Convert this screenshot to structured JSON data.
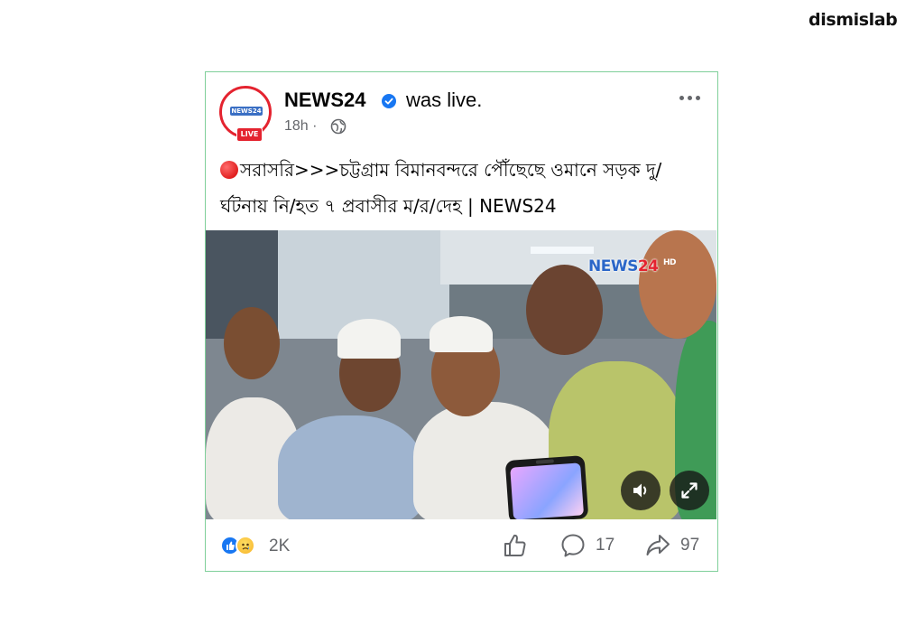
{
  "watermark": "dismislab",
  "post": {
    "avatar": {
      "logo_text": "NEWS24",
      "badge": "LIVE"
    },
    "page_name": "NEWS24",
    "status": "was live.",
    "time": "18h ·",
    "title": "সরাসরি>>>চট্টগ্রাম বিমানবন্দরে পৌঁছেছে ওমানে সড়ক দু/র্ঘটনায় নি/হত ৭ প্রবাসীর ম/র/দেহ | NEWS24",
    "video": {
      "channel_logo_blue": "NEWS",
      "channel_logo_red": "24",
      "channel_logo_hd": "HD"
    },
    "reactions": {
      "icons": [
        "like-icon",
        "sad-icon"
      ],
      "count": "2K"
    },
    "comments_count": "17",
    "shares_count": "97"
  },
  "colors": {
    "card_border": "#7fcf9a",
    "live_red": "#e4232f",
    "facebook_blue": "#1877f2",
    "secondary_text": "#65676b"
  }
}
